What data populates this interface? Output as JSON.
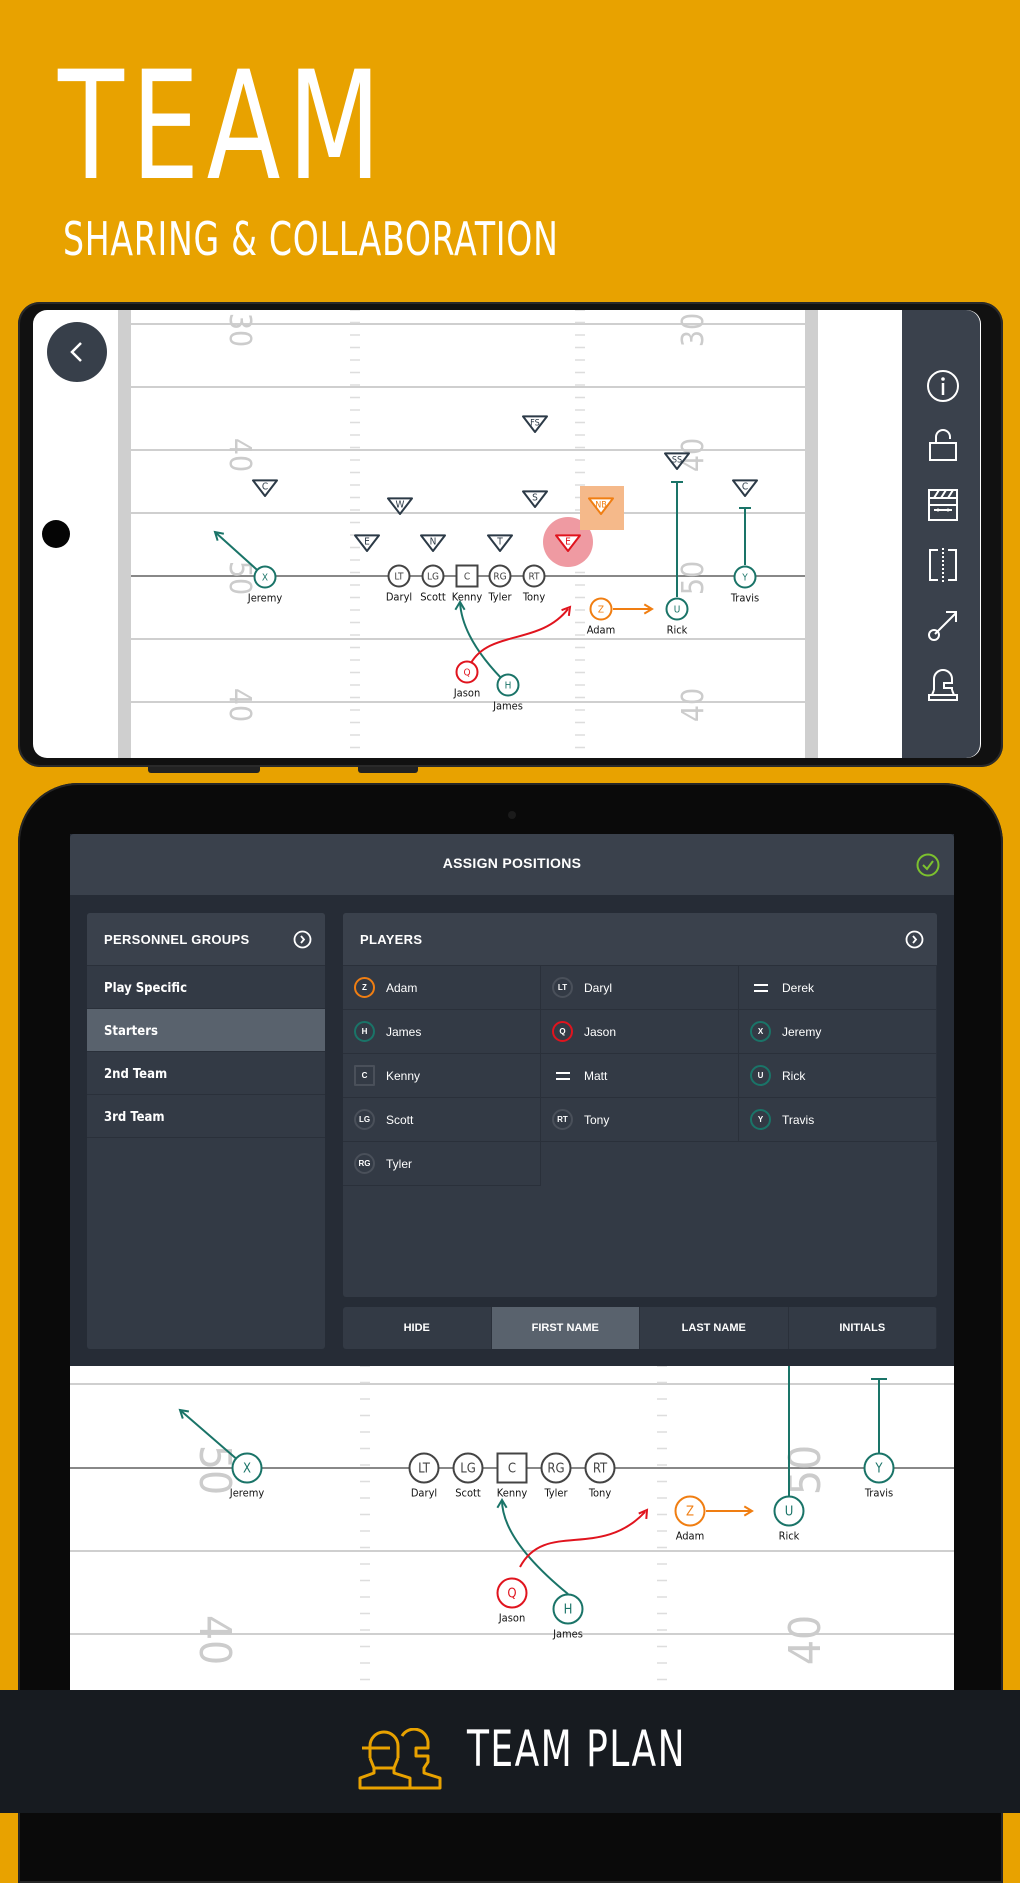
{
  "hero": {
    "title": "TEAM",
    "subtitle": "SHARING & COLLABORATION"
  },
  "colors": {
    "background": "#e8a200",
    "teal": "#1a7468",
    "red": "#e0141e",
    "orange": "#f07e12",
    "defense": "#2c3a47",
    "confirm": "#7cc12e"
  },
  "phone": {
    "back_icon": "chevron-left-icon",
    "sidebar_icons": [
      "info-icon",
      "unlock-icon",
      "clapboard-icon",
      "flip-icon",
      "route-icon",
      "helmet-icon"
    ],
    "yard_numbers": [
      "30",
      "40",
      "50",
      "40",
      "30",
      "40",
      "50",
      "40"
    ]
  },
  "play": {
    "offense": [
      {
        "pos": "X",
        "name": "Jeremy",
        "color": "teal",
        "shape": "circle"
      },
      {
        "pos": "LT",
        "name": "Daryl",
        "color": "gray",
        "shape": "circle"
      },
      {
        "pos": "LG",
        "name": "Scott",
        "color": "gray",
        "shape": "circle"
      },
      {
        "pos": "C",
        "name": "Kenny",
        "color": "gray",
        "shape": "square"
      },
      {
        "pos": "RG",
        "name": "Tyler",
        "color": "gray",
        "shape": "circle"
      },
      {
        "pos": "RT",
        "name": "Tony",
        "color": "gray",
        "shape": "circle"
      },
      {
        "pos": "Z",
        "name": "Adam",
        "color": "orange",
        "shape": "circle"
      },
      {
        "pos": "U",
        "name": "Rick",
        "color": "teal",
        "shape": "circle"
      },
      {
        "pos": "Y",
        "name": "Travis",
        "color": "teal",
        "shape": "circle"
      },
      {
        "pos": "Q",
        "name": "Jason",
        "color": "red",
        "shape": "circle"
      },
      {
        "pos": "H",
        "name": "James",
        "color": "teal",
        "shape": "circle"
      }
    ],
    "defense": [
      "C",
      "W",
      "E",
      "N",
      "T",
      "E",
      "S",
      "FS",
      "NB",
      "SS",
      "C"
    ],
    "highlighted_defender": "E",
    "selected_defender": "NB"
  },
  "dialog": {
    "title": "ASSIGN POSITIONS",
    "confirm_icon": "check-circle-icon",
    "groups": {
      "header": "PERSONNEL GROUPS",
      "items": [
        "Play Specific",
        "Starters",
        "2nd Team",
        "3rd Team"
      ],
      "selected": "Starters"
    },
    "players": {
      "header": "PLAYERS",
      "items": [
        {
          "badge": "Z",
          "name": "Adam",
          "style": "orange"
        },
        {
          "badge": "LT",
          "name": "Daryl",
          "style": "gray"
        },
        {
          "badge": "=",
          "name": "Derek",
          "style": "unassigned"
        },
        {
          "badge": "H",
          "name": "James",
          "style": "teal"
        },
        {
          "badge": "Q",
          "name": "Jason",
          "style": "red"
        },
        {
          "badge": "X",
          "name": "Jeremy",
          "style": "teal"
        },
        {
          "badge": "C",
          "name": "Kenny",
          "style": "square"
        },
        {
          "badge": "=",
          "name": "Matt",
          "style": "unassigned"
        },
        {
          "badge": "U",
          "name": "Rick",
          "style": "teal"
        },
        {
          "badge": "LG",
          "name": "Scott",
          "style": "gray"
        },
        {
          "badge": "RT",
          "name": "Tony",
          "style": "gray"
        },
        {
          "badge": "Y",
          "name": "Travis",
          "style": "teal"
        },
        {
          "badge": "RG",
          "name": "Tyler",
          "style": "gray"
        }
      ]
    },
    "label_modes": [
      "HIDE",
      "FIRST NAME",
      "LAST NAME",
      "INITIALS"
    ],
    "label_mode_selected": "FIRST NAME"
  },
  "footer": {
    "brand": "TEAM PLAN",
    "logo_icon": "team-helmets-icon"
  }
}
